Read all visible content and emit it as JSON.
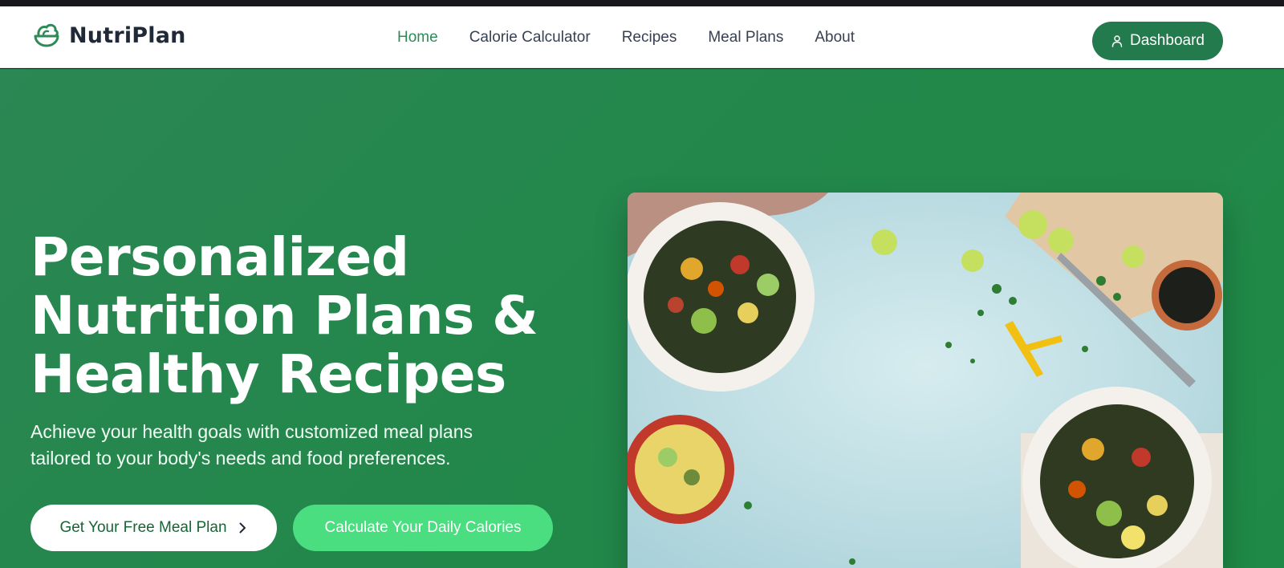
{
  "brand": {
    "name": "NutriPlan",
    "icon": "salad-bowl-icon",
    "color": "#2e8b57"
  },
  "nav": {
    "items": [
      {
        "label": "Home",
        "active": true
      },
      {
        "label": "Calorie Calculator",
        "active": false
      },
      {
        "label": "Recipes",
        "active": false
      },
      {
        "label": "Meal Plans",
        "active": false
      },
      {
        "label": "About",
        "active": false
      }
    ],
    "dashboard": {
      "label": "Dashboard",
      "icon": "user-icon"
    }
  },
  "hero": {
    "title_lines": [
      "Personalized",
      "Nutrition Plans &",
      "Healthy Recipes"
    ],
    "subtitle_lines": [
      "Achieve your health goals with customized meal plans",
      "tailored to your body's needs and food preferences."
    ],
    "primary_cta": {
      "label": "Get Your Free Meal Plan",
      "icon": "chevron-right-icon"
    },
    "secondary_cta": {
      "label": "Calculate Your Daily Calories"
    },
    "image": "healthy-food-bowls-photo"
  },
  "colors": {
    "hero_bg": "#23874b",
    "accent_green": "#4ade80",
    "dashboard_btn": "#237a4c",
    "nav_text": "#374151"
  }
}
